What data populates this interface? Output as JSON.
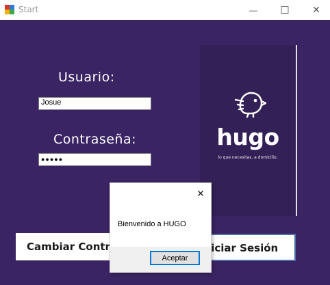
{
  "window": {
    "title": "Start",
    "minimize_glyph": "—",
    "maximize_glyph": "☐",
    "close_glyph": "✕"
  },
  "login": {
    "user_label": "Usuario:",
    "user_value": "Josue",
    "password_label": "Contraseña:",
    "password_value": "●●●●●"
  },
  "brand": {
    "name": "hugo",
    "tagline": "lo que necesitas, a domicilio."
  },
  "buttons": {
    "change_password": "Cambiar Contraseña",
    "login": "Iniciar Sesión"
  },
  "dialog": {
    "message": "Bienvenido a HUGO",
    "ok_label": "Aceptar",
    "close_glyph": "✕"
  },
  "colors": {
    "background": "#3a2464",
    "brand_panel": "#332056",
    "accent": "#0078d7"
  },
  "icons": [
    "app-icon",
    "bird-logo-icon",
    "close-icon"
  ]
}
